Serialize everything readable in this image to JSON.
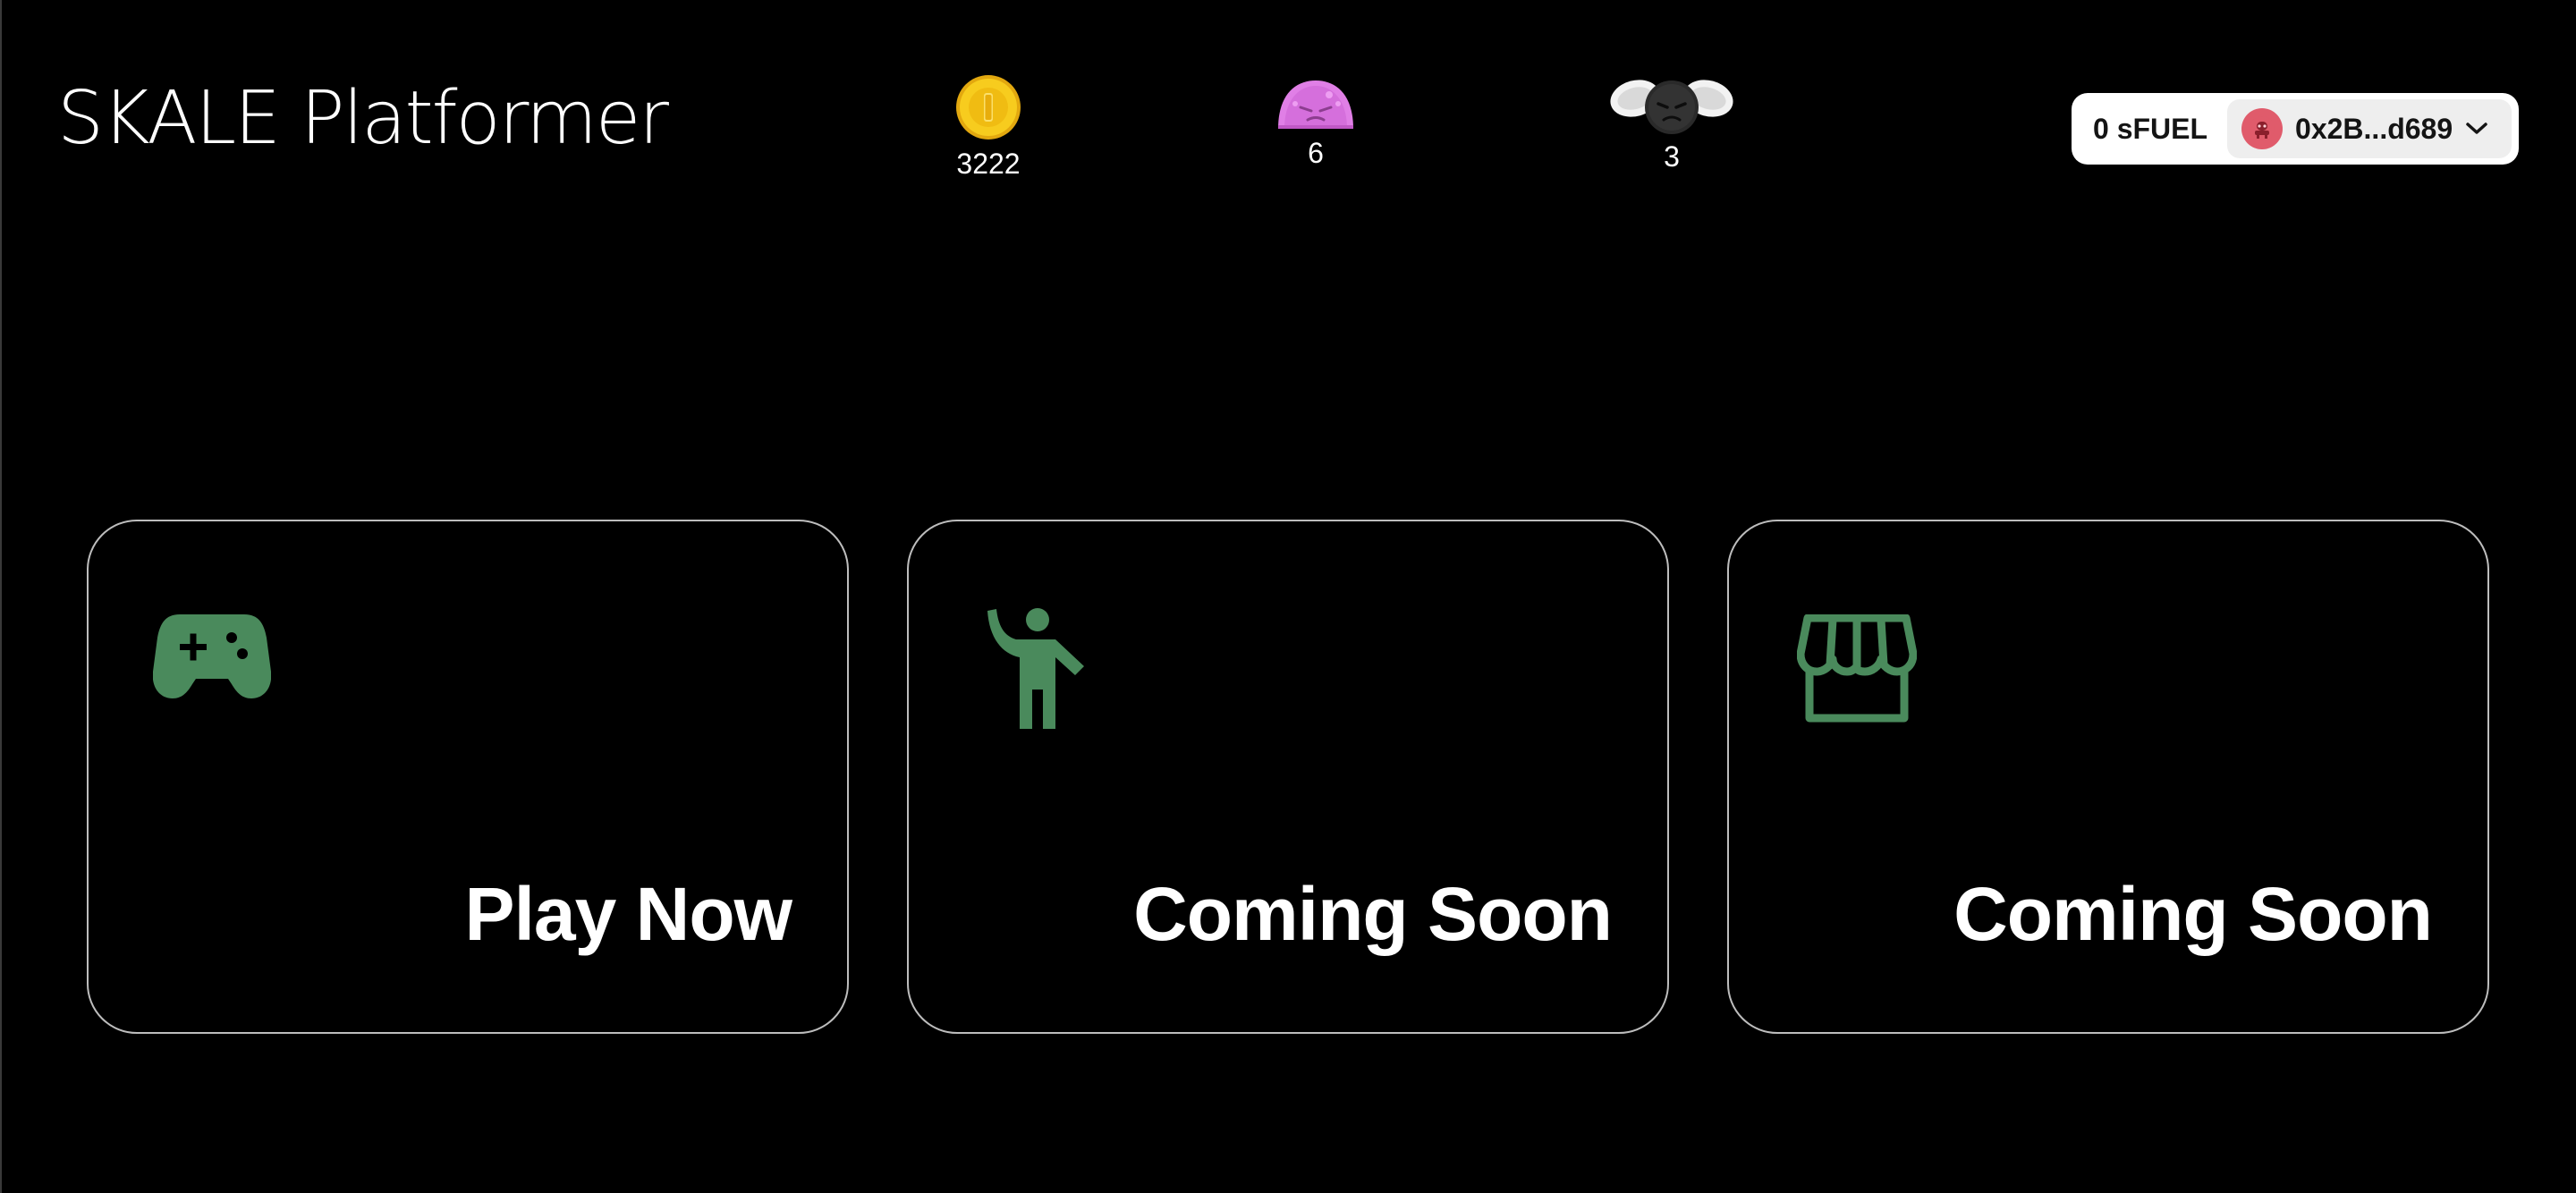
{
  "header": {
    "title": "SKALE Platformer"
  },
  "stats": {
    "coins": {
      "icon": "coin-icon",
      "value": "3222"
    },
    "slimes": {
      "icon": "slime-enemy-icon",
      "value": "6"
    },
    "flies": {
      "icon": "fly-enemy-icon",
      "value": "3"
    }
  },
  "wallet": {
    "fuel": "0 sFUEL",
    "address": "0x2B...d689",
    "avatar_icon": "account-avatar-icon",
    "chevron_icon": "chevron-down-icon"
  },
  "cards": [
    {
      "icon": "gamepad-icon",
      "label": "Play Now"
    },
    {
      "icon": "waving-person-icon",
      "label": "Coming Soon"
    },
    {
      "icon": "storefront-icon",
      "label": "Coming Soon"
    }
  ],
  "colors": {
    "background": "#000000",
    "accent_green": "#4a8a5c",
    "card_border": "#bdbdbd",
    "coin_gold": "#f2c318",
    "slime_pink": "#e07fe6",
    "avatar_red": "#e05b6b"
  }
}
